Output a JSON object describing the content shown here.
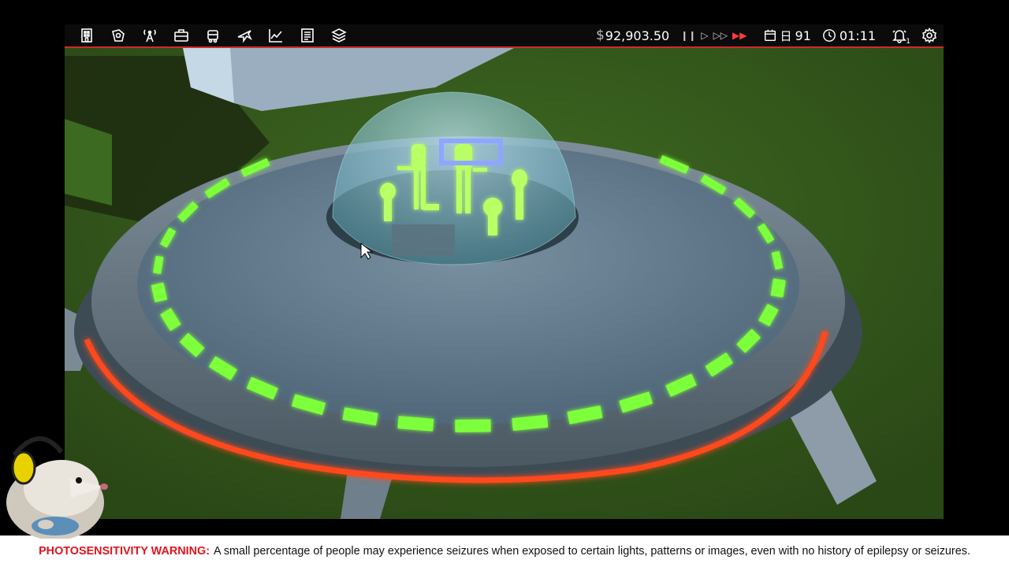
{
  "toolbar": {
    "tools": [
      {
        "name": "build-tool",
        "icon": "building-icon"
      },
      {
        "name": "zone-tool",
        "icon": "zone-icon"
      },
      {
        "name": "broadcast-tool",
        "icon": "antenna-icon"
      },
      {
        "name": "staff-tool",
        "icon": "briefcase-icon"
      },
      {
        "name": "transport-tool",
        "icon": "truck-icon"
      },
      {
        "name": "flights-tool",
        "icon": "plane-icon"
      },
      {
        "name": "stats-tool",
        "icon": "chart-icon"
      },
      {
        "name": "journal-tool",
        "icon": "book-icon"
      },
      {
        "name": "layers-tool",
        "icon": "layers-icon"
      }
    ]
  },
  "hud": {
    "currency_symbol": "$",
    "money": "92,903.50",
    "speed": {
      "pause": "❙❙",
      "play": "▷",
      "fast": "▷▷",
      "fastest": "▶▶"
    },
    "day": "91",
    "time": "01:11",
    "notifications_count": "1"
  },
  "warning": {
    "label": "PHOTOSENSITIVITY WARNING:",
    "text": "A small percentage of people may experience seizures when exposed to certain lights, patterns or images, even with no history of epilepsy or seizures."
  },
  "colors": {
    "accent": "#d42a2a",
    "green_light": "#7dff3a",
    "red_light": "#ff4a1a",
    "warning_label": "#e0141e"
  }
}
